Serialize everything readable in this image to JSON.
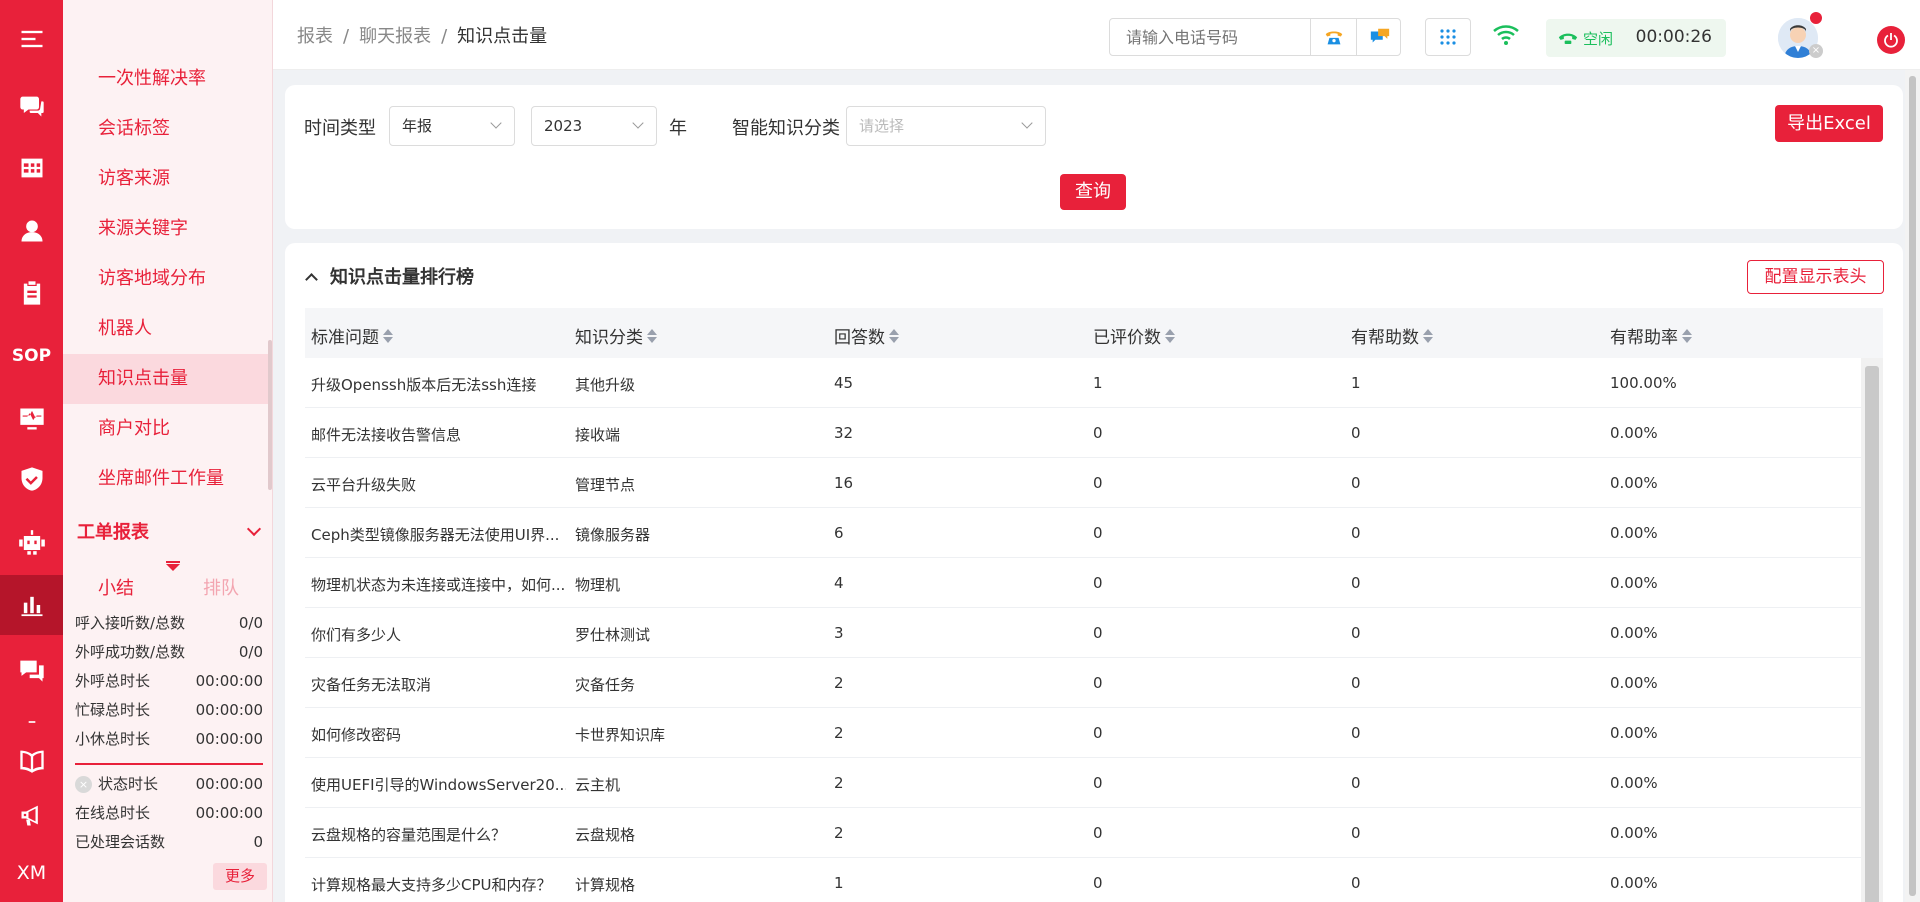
{
  "breadcrumb": [
    "报表",
    "聊天报表",
    "知识点击量"
  ],
  "breadcrumb_sep": "/",
  "header": {
    "phone_placeholder": "请输入电话号码",
    "status_label": "空闲",
    "timer": "00:00:26"
  },
  "rail": {
    "sop_label": "SOP",
    "xm_label": "XM",
    "active_item": "report-chart"
  },
  "sidebar": {
    "items": [
      {
        "label": "一次性解决率",
        "active": false
      },
      {
        "label": "会话标签",
        "active": false
      },
      {
        "label": "访客来源",
        "active": false
      },
      {
        "label": "来源关键字",
        "active": false
      },
      {
        "label": "访客地域分布",
        "active": false
      },
      {
        "label": "机器人",
        "active": false
      },
      {
        "label": "知识点击量",
        "active": true
      },
      {
        "label": "商户对比",
        "active": false
      },
      {
        "label": "坐席邮件工作量",
        "active": false
      }
    ],
    "group_label": "工单报表",
    "sub_tabs": [
      "小结",
      "排队"
    ],
    "stats": [
      {
        "label": "呼入接听数/总数",
        "value": "0/0"
      },
      {
        "label": "外呼成功数/总数",
        "value": "0/0"
      },
      {
        "label": "外呼总时长",
        "value": "00:00:00"
      },
      {
        "label": "忙碌总时长",
        "value": "00:00:00"
      },
      {
        "label": "小休总时长",
        "value": "00:00:00"
      }
    ],
    "stats2": [
      {
        "label": "状态时长",
        "value": "00:00:00"
      },
      {
        "label": "在线总时长",
        "value": "00:00:00"
      },
      {
        "label": "已处理会话数",
        "value": "0"
      }
    ],
    "more_label": "更多"
  },
  "filters": {
    "time_type_label": "时间类型",
    "time_type_value": "年报",
    "year_value": "2023",
    "year_unit": "年",
    "category_label": "智能知识分类",
    "category_placeholder": "请选择",
    "export_label": "导出Excel",
    "query_label": "查询"
  },
  "table": {
    "title": "知识点击量排行榜",
    "config_label": "配置显示表头",
    "columns": [
      "标准问题",
      "知识分类",
      "回答数",
      "已评价数",
      "有帮助数",
      "有帮助率"
    ],
    "rows": [
      [
        "升级Openssh版本后无法ssh连接",
        "其他升级",
        "45",
        "1",
        "1",
        "100.00%"
      ],
      [
        "邮件无法接收告警信息",
        "接收端",
        "32",
        "0",
        "0",
        "0.00%"
      ],
      [
        "云平台升级失败",
        "管理节点",
        "16",
        "0",
        "0",
        "0.00%"
      ],
      [
        "Ceph类型镜像服务器无法使用UI界...",
        "镜像服务器",
        "6",
        "0",
        "0",
        "0.00%"
      ],
      [
        "物理机状态为未连接或连接中，如何...",
        "物理机",
        "4",
        "0",
        "0",
        "0.00%"
      ],
      [
        "你们有多少人",
        "罗仕林测试",
        "3",
        "0",
        "0",
        "0.00%"
      ],
      [
        "灾备任务无法取消",
        "灾备任务",
        "2",
        "0",
        "0",
        "0.00%"
      ],
      [
        "如何修改密码",
        "卡世界知识库",
        "2",
        "0",
        "0",
        "0.00%"
      ],
      [
        "使用UEFI引导的WindowsServer20...",
        "云主机",
        "2",
        "0",
        "0",
        "0.00%"
      ],
      [
        "云盘规格的容量范围是什么？",
        "云盘规格",
        "2",
        "0",
        "0",
        "0.00%"
      ],
      [
        "计算规格最大支持多少CPU和内存？",
        "计算规格",
        "1",
        "0",
        "0",
        "0.00%"
      ]
    ]
  },
  "colors": {
    "brand": "#e8213a",
    "sidebar_bg": "#fdf2f3",
    "status_green": "#1bbf5c"
  }
}
